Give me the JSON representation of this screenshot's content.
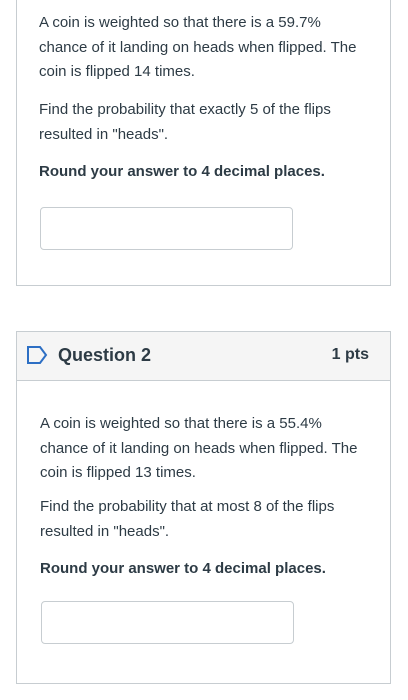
{
  "question1": {
    "paragraphs": [
      "A coin is weighted so that there is a 59.7% chance of it landing on heads when flipped. The coin is flipped 14 times.",
      "Find the probability that exactly 5 of the flips resulted in \"heads\"."
    ],
    "instruction": "Round your answer to 4 decimal places.",
    "answer_value": ""
  },
  "question2": {
    "title": "Question 2",
    "points": "1 pts",
    "flag_icon": "flag-outline-icon",
    "paragraphs": [
      "A coin is weighted so that there is a 55.4% chance of it landing on heads when flipped. The coin is flipped 13 times.",
      "Find the probability that at most 8 of the flips resulted in \"heads\"."
    ],
    "instruction": "Round your answer to 4 decimal places.",
    "answer_value": ""
  },
  "colors": {
    "border": "#c7cdd1",
    "header_bg": "#f5f5f5",
    "flag": "#2d6fc4",
    "text": "#2d3b45"
  }
}
